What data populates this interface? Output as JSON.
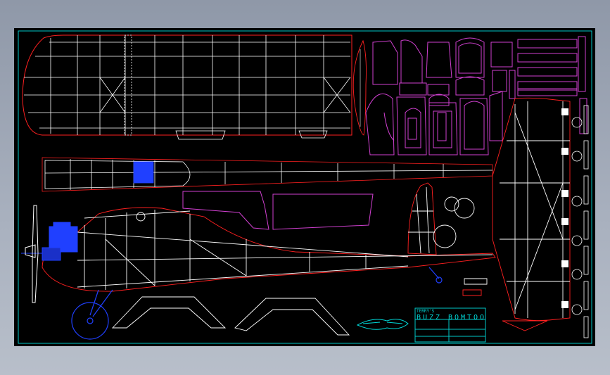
{
  "title_block": {
    "line1": "TERRY'S",
    "name": "BUZZ BOMTOO",
    "cells": [
      "",
      "",
      "",
      "",
      "",
      ""
    ]
  },
  "colors": {
    "background": "#000000",
    "frame": "#00c8c8",
    "structure": "#ffffff",
    "outline": "#ff2020",
    "parts": "#d040d0",
    "engine": "#2040ff",
    "logo": "#00d8d8",
    "desktop": "#9aa2b0"
  }
}
